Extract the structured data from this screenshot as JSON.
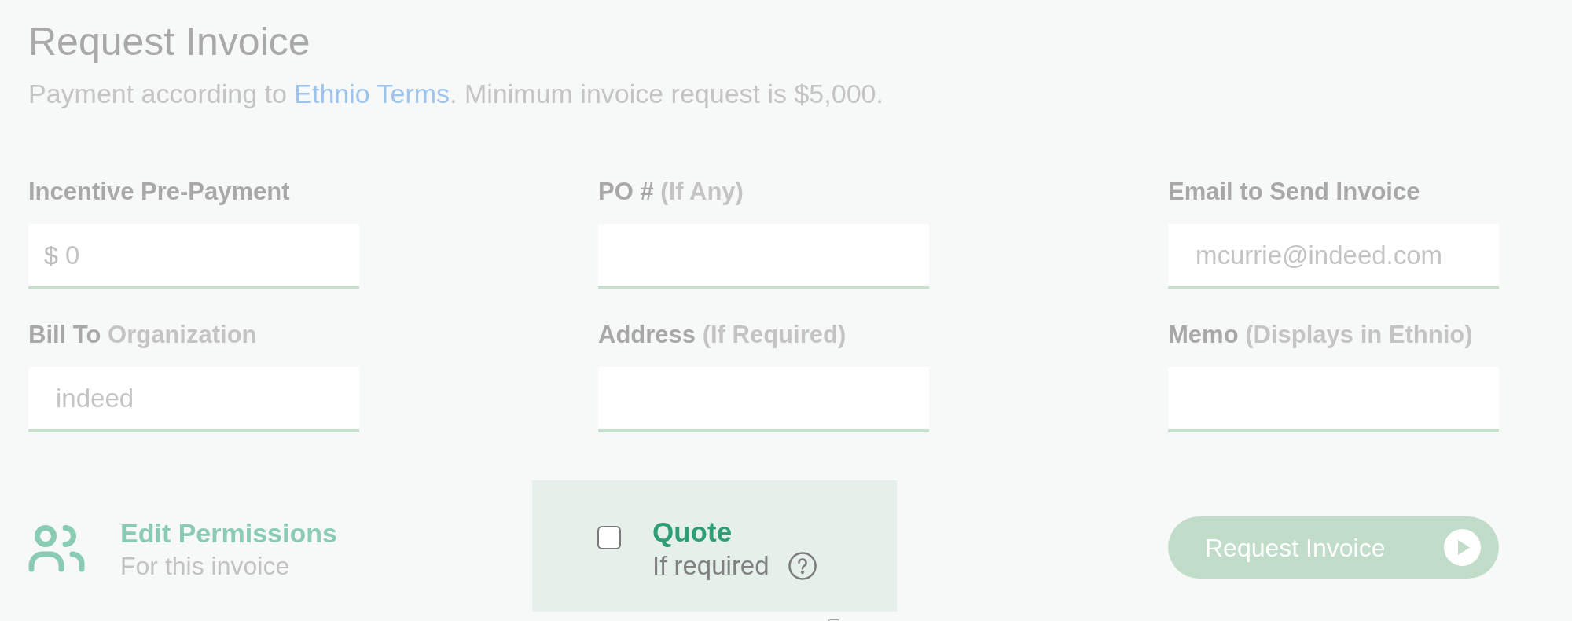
{
  "header": {
    "title": "Request Invoice",
    "description": {
      "before": "Payment according to",
      "link": "Ethnio Terms",
      "after": ". Minimum invoice request is $5,000."
    }
  },
  "fields": [
    {
      "label": "Incentive Pre-Payment",
      "prefix": "$",
      "placeholder": "0"
    },
    {
      "label": "PO #",
      "hint": "(If Any)"
    },
    {
      "label": "Email to Send Invoice",
      "placeholder": "mcurrie@indeed.com"
    },
    {
      "label": "Bill To",
      "hint": "Organization",
      "placeholder": "indeed"
    },
    {
      "label": "Address",
      "hint": "(If Required)"
    },
    {
      "label": "Memo",
      "hint": "(Displays in Ethnio)"
    }
  ],
  "permissions": {
    "title": "Edit Permissions",
    "subtitle": "For this invoice",
    "disabled": true
  },
  "quote": {
    "title": "Quote",
    "subtitle": "If required",
    "checked": false
  },
  "submit": {
    "label": "Request Invoice",
    "disabled": true
  }
}
